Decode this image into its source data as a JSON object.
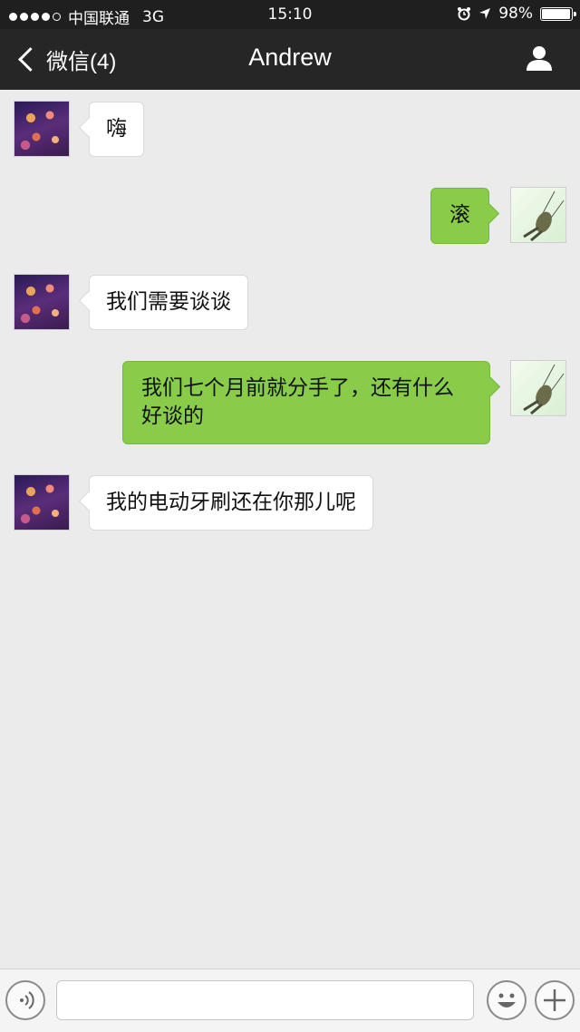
{
  "status_bar": {
    "carrier": "中国联通",
    "network": "3G",
    "time": "15:10",
    "battery": "98%",
    "battery_level": 0.98
  },
  "nav": {
    "back_label": "微信(4)",
    "title": "Andrew"
  },
  "messages": [
    {
      "side": "in",
      "text": "嗨"
    },
    {
      "side": "out",
      "text": "滚"
    },
    {
      "side": "in",
      "text": "我们需要谈谈"
    },
    {
      "side": "out",
      "text": "我们七个月前就分手了，还有什么好谈的"
    },
    {
      "side": "in",
      "text": "我的电动牙刷还在你那儿呢"
    }
  ],
  "input_bar": {
    "text_value": "",
    "icons": [
      "voice-icon",
      "emoji-icon",
      "plus-icon"
    ]
  },
  "colors": {
    "outgoing_bubble": "#88cc4a",
    "incoming_bubble": "#ffffff",
    "chat_background": "#ebebeb",
    "nav_background": "#262626"
  }
}
